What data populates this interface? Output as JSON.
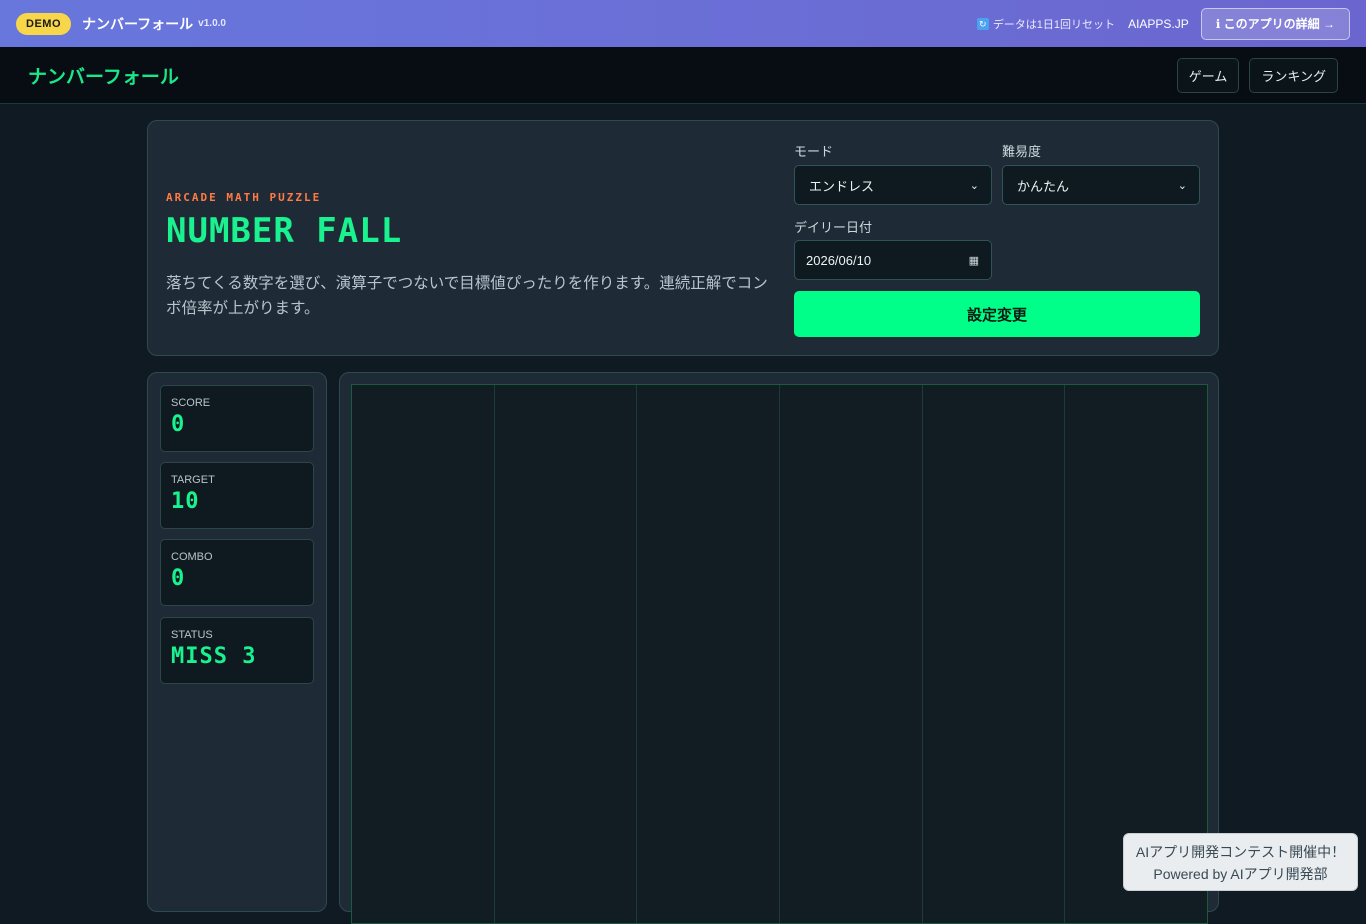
{
  "demo_bar": {
    "badge": "DEMO",
    "app_name": "ナンバーフォール",
    "version": "v1.0.0",
    "reset_note": "データは1日1回リセット",
    "reset_icon": "refresh-icon",
    "site_link": "AIAPPS.JP",
    "details_button": "ℹ このアプリの詳細 →"
  },
  "nav": {
    "brand": "ナンバーフォール",
    "items": [
      {
        "label": "ゲーム"
      },
      {
        "label": "ランキング"
      }
    ]
  },
  "settings": {
    "eyebrow": "ARCADE MATH PUZZLE",
    "title": "NUMBER FALL",
    "description": "落ちてくる数字を選び、演算子でつないで目標値ぴったりを作ります。連続正解でコンボ倍率が上がります。",
    "mode_label": "モード",
    "mode_value": "エンドレス",
    "difficulty_label": "難易度",
    "difficulty_value": "かんたん",
    "date_label": "デイリー日付",
    "date_value": "2026/06/10",
    "apply_button": "設定変更"
  },
  "stats": [
    {
      "label": "SCORE",
      "value": "0"
    },
    {
      "label": "TARGET",
      "value": "10"
    },
    {
      "label": "COMBO",
      "value": "0"
    },
    {
      "label": "STATUS",
      "value": "MISS 3"
    }
  ],
  "board": {
    "columns": 6
  },
  "contest": {
    "line1": "AIアプリ開発コンテスト開催中！",
    "line2": "Powered by AIアプリ開発部"
  },
  "colors": {
    "accent": "#00ff88",
    "eyebrow": "#ff7a45",
    "demo_badge": "#f7d64a"
  }
}
